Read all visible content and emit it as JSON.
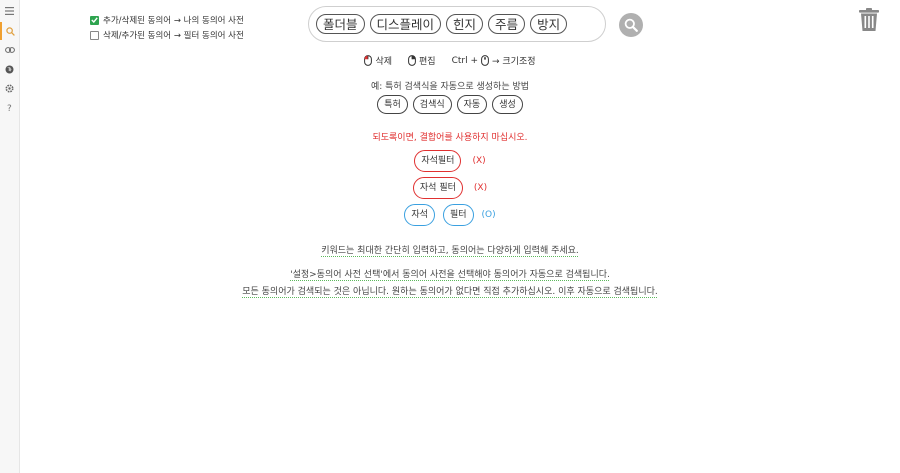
{
  "options": [
    {
      "label": "추가/삭제된 동의어 → 나의 동의어 사전",
      "checked": true
    },
    {
      "label": "삭제/추가된 동의어 → 필터 동의어 사전",
      "checked": false
    }
  ],
  "search": {
    "chips": [
      "폴더블",
      "디스플레이",
      "힌지",
      "주름",
      "방지"
    ]
  },
  "hint": {
    "delete_label": "삭제",
    "edit_label": "편집",
    "ctrl_label": "Ctrl +",
    "resize_label": "→ 크기조정"
  },
  "example": {
    "title": "예: 특허 검색식을 자동으로 생성하는 방법",
    "chips": [
      "특허",
      "검색식",
      "자동",
      "생성"
    ]
  },
  "warning": "되도록이면, 결합어를 사용하지 마십시오.",
  "samples": {
    "bad1": {
      "chip": "자석필터",
      "mark": "(X)"
    },
    "bad2": {
      "chip": "자석 필터",
      "mark": "(X)"
    },
    "good": {
      "chips": [
        "자석",
        "필터"
      ],
      "mark": "(O)"
    }
  },
  "tips": {
    "line1": "키워드는 최대한 간단히 입력하고, 동의어는 다양하게 입력해 주세요.",
    "line2": "'설정>동의어 사전 선택'에서 동의어 사전을 선택해야 동의어가 자동으로 검색됩니다.",
    "line3": "모든 동의어가 검색되는 것은 아닙니다. 원하는 동의어가 없다면 직접 추가하십시오. 이후 자동으로 검색됩니다."
  },
  "colors": {
    "accent": "#f0a030",
    "check": "#2ea44f",
    "warning": "#e03030",
    "ok": "#3aa0e0"
  }
}
